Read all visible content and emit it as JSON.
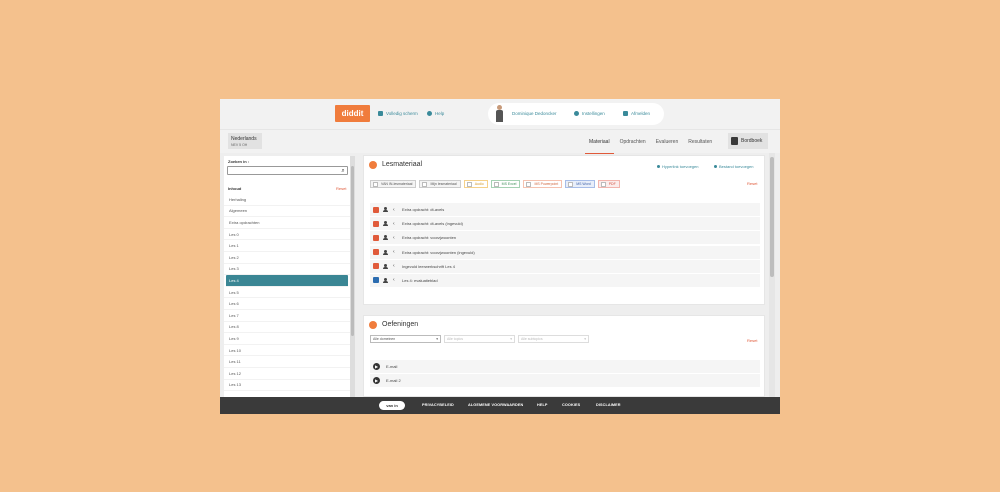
{
  "colors": {
    "background": "#f4c18d",
    "accent": "#e05a3a",
    "teal": "#3a8694",
    "brand": "#f07c3c"
  },
  "header": {
    "logo": "diddit",
    "fullscreen_label": "Volledig scherm",
    "help_label": "Help",
    "user_name": "Dominique Dedoncker",
    "settings_label": "Instellingen",
    "logout_label": "Afmelden"
  },
  "subbar": {
    "language": "Nederlands",
    "course": "NEV 5 OH",
    "tabs": [
      "Materiaal",
      "Opdrachten",
      "Evalueren",
      "Resultaten"
    ],
    "active_tab": "Materiaal",
    "bordboek_label": "Bordboek"
  },
  "sidebar": {
    "search_label": "Zoeken in :",
    "search_value": "",
    "inhoud_label": "Inhoud",
    "reset_label": "Reset",
    "items": [
      "Herhaling",
      "Algemeen",
      "Extra opdrachten",
      "Les 0",
      "Les 1",
      "Les 2",
      "Les 3",
      "Les 4",
      "Les 5",
      "Les 6",
      "Les 7",
      "Les 8",
      "Les 9",
      "Les 10",
      "Les 11",
      "Les 12",
      "Les 13"
    ],
    "active_item": "Les 4"
  },
  "lesmateriaal": {
    "title": "Lesmateriaal",
    "add_link_label": "Hyperlink toevoegen",
    "add_file_label": "Bestand toevoegen",
    "reset_label": "Reset",
    "filters": [
      "VAN IN-lesmateriaal",
      "Mijn lesmateriaal",
      "Audio",
      "MS Excel",
      "MS Powerpoint",
      "MS Word",
      "PDF"
    ],
    "rows": [
      {
        "icon": "pdf-icon",
        "title": "Extra opdracht: dt-avels"
      },
      {
        "icon": "pdf-icon",
        "title": "Extra opdracht: dt-avels (ingevuld)"
      },
      {
        "icon": "pdf-icon",
        "title": "Extra opdracht: voorzjwoonten"
      },
      {
        "icon": "pdf-icon",
        "title": "Extra opdracht: voorzjwoonten (ingevuld)"
      },
      {
        "icon": "pdf-icon",
        "title": "Ingevuld leerwerkschrift Les 4"
      },
      {
        "icon": "word-icon",
        "title": "Les 4: evaluatieblad"
      }
    ]
  },
  "oefeningen": {
    "title": "Oefeningen",
    "reset_label": "Reset",
    "selects": [
      "Alle domeinen",
      "Alle topics",
      "Alle subtopics"
    ],
    "rows": [
      "E-mail",
      "E-mail 2"
    ]
  },
  "footer": {
    "logo": "van in",
    "links": [
      "PRIVACYBELEID",
      "ALGEMENE VOORWAARDEN",
      "HELP",
      "COOKIES",
      "DISCLAIMER"
    ]
  }
}
